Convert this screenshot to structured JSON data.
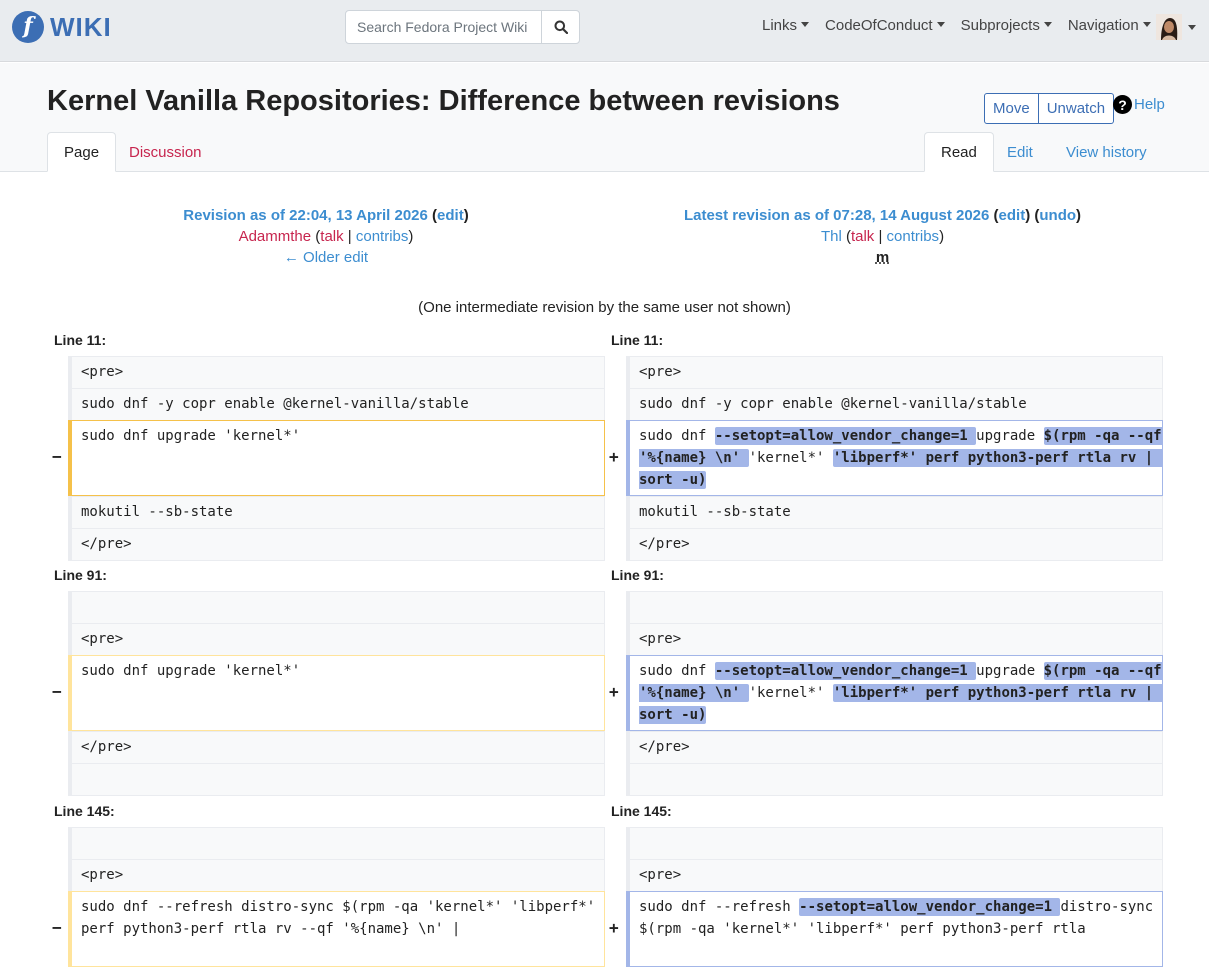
{
  "navbar": {
    "logo_text": "WIKI",
    "search_placeholder": "Search Fedora Project Wiki",
    "menus": [
      "Links",
      "CodeOfConduct",
      "Subprojects",
      "Navigation"
    ]
  },
  "page": {
    "title": "Kernel Vanilla Repositories: Difference between revisions",
    "actions": {
      "move": "Move",
      "unwatch": "Unwatch",
      "help": "Help"
    },
    "tabs_left": [
      "Page",
      "Discussion"
    ],
    "tabs_right": [
      "Read",
      "Edit",
      "View history"
    ]
  },
  "diff": {
    "left": {
      "revision": "Revision as of 22:04, 13 April 2026",
      "edit": "edit",
      "user": "Adammthe",
      "talk": "talk",
      "contribs": "contribs",
      "older": "← Older edit"
    },
    "right": {
      "revision": "Latest revision as of 07:28, 14 August 2026",
      "edit": "edit",
      "undo": "undo",
      "user": "Thl",
      "talk": "talk",
      "contribs": "contribs",
      "minor": "m"
    },
    "intermediate": "(One intermediate revision by the same user not shown)",
    "hunks": [
      {
        "label": "Line 11:",
        "ctx_before": [
          "<pre>",
          "sudo dnf -y copr enable @kernel-vanilla/stable"
        ],
        "removed": "sudo dnf upgrade 'kernel*'",
        "added_parts": [
          {
            "t": "sudo dnf ",
            "h": false
          },
          {
            "t": "--setopt=allow_vendor_change=1 ",
            "h": true
          },
          {
            "t": "upgrade ",
            "h": false
          },
          {
            "t": "$(rpm -qa --qf '%{name} \\n' ",
            "h": true
          },
          {
            "t": "'kernel*' ",
            "h": false
          },
          {
            "t": "'libperf*' perf python3-perf rtla rv | sort -u)",
            "h": true
          }
        ],
        "ctx_after": [
          "mokutil --sb-state",
          "</pre>"
        ]
      },
      {
        "label": "Line 91:",
        "ctx_before": [
          "",
          "<pre>"
        ],
        "removed": "sudo dnf upgrade 'kernel*'",
        "added_parts": [
          {
            "t": "sudo dnf ",
            "h": false
          },
          {
            "t": "--setopt=allow_vendor_change=1 ",
            "h": true
          },
          {
            "t": "upgrade ",
            "h": false
          },
          {
            "t": "$(rpm -qa --qf '%{name} \\n' ",
            "h": true
          },
          {
            "t": "'kernel*' ",
            "h": false
          },
          {
            "t": "'libperf*' perf python3-perf rtla rv | sort -u)",
            "h": true
          }
        ],
        "ctx_after": [
          "</pre>",
          ""
        ]
      },
      {
        "label": "Line 145:",
        "ctx_before": [
          "",
          "<pre>"
        ],
        "removed": "sudo dnf --refresh distro-sync $(rpm -qa 'kernel*' 'libperf*' perf python3-perf rtla rv --qf '%{name} \\n' |",
        "added_parts": [
          {
            "t": "sudo dnf --refresh ",
            "h": false
          },
          {
            "t": "--setopt=allow_vendor_change=1 ",
            "h": true
          },
          {
            "t": "distro-sync $(rpm -qa 'kernel*' 'libperf*' perf python3-perf rtla",
            "h": false
          }
        ],
        "ctx_after": []
      }
    ],
    "minus": "−",
    "plus": "+"
  }
}
